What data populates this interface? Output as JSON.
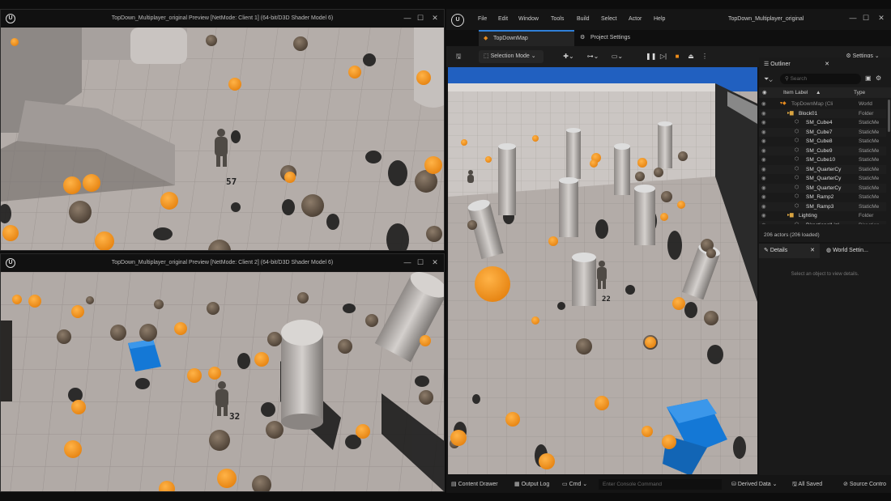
{
  "client1": {
    "title": "TopDown_Multiplayer_original Preview [NetMode: Client 1]  (64-bit/D3D Shader Model 6)",
    "player_number": "57"
  },
  "client2": {
    "title": "TopDown_Multiplayer_original Preview [NetMode: Client 2]  (64-bit/D3D Shader Model 6)",
    "player_number": "32"
  },
  "editor": {
    "window_title": "TopDown_Multiplayer_original",
    "menu": [
      "File",
      "Edit",
      "Window",
      "Tools",
      "Build",
      "Select",
      "Actor",
      "Help"
    ],
    "tabs": [
      {
        "label": "TopDownMap",
        "active": true
      },
      {
        "label": "Project Settings",
        "active": false
      }
    ],
    "toolbar": {
      "mode_label": "Selection Mode",
      "settings_label": "Settings"
    },
    "viewport": {
      "player_number": "22"
    },
    "outliner": {
      "tab_label": "Outliner",
      "search_placeholder": "Search",
      "col_label": "Item Label",
      "col_type": "Type",
      "rows": [
        {
          "label": "TopDownMap (Cli",
          "type": "World",
          "indent": 0
        },
        {
          "label": "Block01",
          "type": "Folder",
          "indent": 1
        },
        {
          "label": "SM_Cube4",
          "type": "StaticMe",
          "indent": 2
        },
        {
          "label": "SM_Cube7",
          "type": "StaticMe",
          "indent": 2
        },
        {
          "label": "SM_Cube8",
          "type": "StaticMe",
          "indent": 2
        },
        {
          "label": "SM_Cube9",
          "type": "StaticMe",
          "indent": 2
        },
        {
          "label": "SM_Cube10",
          "type": "StaticMe",
          "indent": 2
        },
        {
          "label": "SM_QuarterCy",
          "type": "StaticMe",
          "indent": 2
        },
        {
          "label": "SM_QuarterCy",
          "type": "StaticMe",
          "indent": 2
        },
        {
          "label": "SM_QuarterCy",
          "type": "StaticMe",
          "indent": 2
        },
        {
          "label": "SM_Ramp2",
          "type": "StaticMe",
          "indent": 2
        },
        {
          "label": "SM_Ramp3",
          "type": "StaticMe",
          "indent": 2
        },
        {
          "label": "Lighting",
          "type": "Folder",
          "indent": 1
        },
        {
          "label": "DirectionalLigl",
          "type": "Direction",
          "indent": 2
        }
      ],
      "actor_count": "206 actors (206 loaded)"
    },
    "details": {
      "tab_label": "Details",
      "world_tab_label": "World Settin...",
      "empty_text": "Select an object to view details."
    },
    "statusbar": {
      "content_drawer": "Content Drawer",
      "output_log": "Output Log",
      "cmd": "Cmd",
      "console_placeholder": "Enter Console Command",
      "derived_data": "Derived Data",
      "all_saved": "All Saved",
      "source_control": "Source Contro"
    }
  },
  "colors": {
    "accent": "#2f7fd8",
    "floor": "#b3aca8",
    "orange": "#f59a1c",
    "blue_cube": "#1478d6"
  }
}
